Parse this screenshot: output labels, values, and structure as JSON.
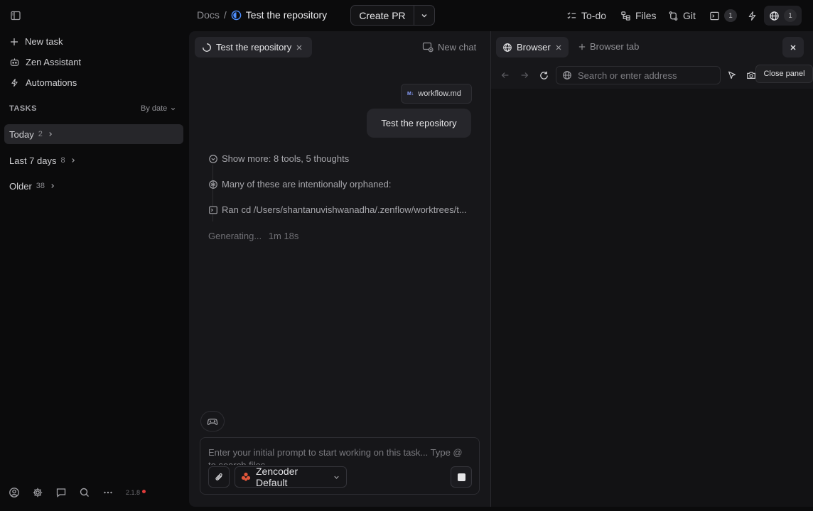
{
  "topbar": {
    "breadcrumb_root": "Docs",
    "breadcrumb_sep": "/",
    "breadcrumb_task": "Test the repository",
    "create_pr_label": "Create PR",
    "todo_label": "To-do",
    "files_label": "Files",
    "git_label": "Git",
    "terminal_count": "1",
    "browser_count": "1"
  },
  "sidebar": {
    "new_task": "New task",
    "assistant": "Zen Assistant",
    "automations": "Automations",
    "tasks_header": "TASKS",
    "sort_label": "By date",
    "groups": [
      {
        "label": "Today",
        "count": "2"
      },
      {
        "label": "Last 7 days",
        "count": "8"
      },
      {
        "label": "Older",
        "count": "38"
      }
    ],
    "version": "2.1.8"
  },
  "chat": {
    "tab_label": "Test the repository",
    "new_chat_label": "New chat",
    "attachment_badge": "M↓",
    "attachment_name": "workflow.md",
    "user_message": "Test the repository",
    "activity": [
      "Show more: 8 tools, 5 thoughts",
      "Many of these are intentionally orphaned:",
      "Ran cd /Users/shantanuvishwanadha/.zenflow/worktrees/t..."
    ],
    "generating": "Generating...",
    "elapsed": "1m 18s",
    "prompt_placeholder": "Enter your initial prompt to start working on this task... Type @ to search files",
    "model_label": "Zencoder Default"
  },
  "browser": {
    "tab_label": "Browser",
    "new_tab_label": "Browser tab",
    "address_placeholder": "Search or enter address",
    "tooltip": "Close panel"
  },
  "colors": {
    "accent_blue": "#4c8dff",
    "model_icon": "#e0563a",
    "status_dot": "#e03b3b"
  }
}
